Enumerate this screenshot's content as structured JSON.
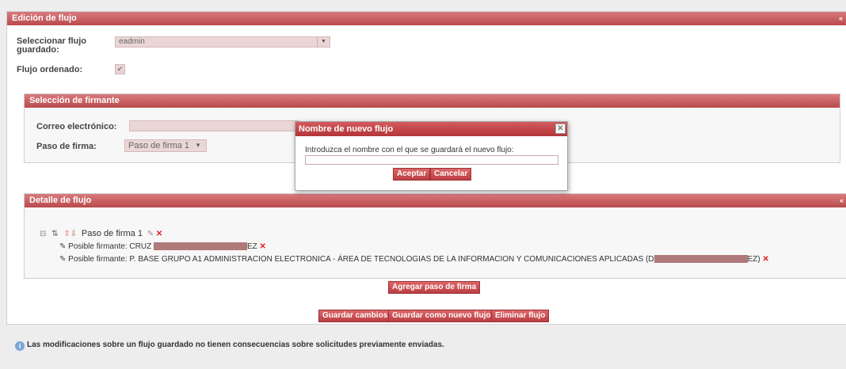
{
  "flow_edit": {
    "title": "Edición de flujo",
    "collapse": "«",
    "select_label": "Seleccionar flujo guardado:",
    "select_value": "eadmin",
    "ordered_label": "Flujo ordenado:",
    "ordered_checked": "✔"
  },
  "signer_select": {
    "title": "Selección de firmante",
    "email_label": "Correo electrónico:",
    "step_label": "Paso de firma:",
    "step_value": "Paso de firma 1"
  },
  "flow_detail": {
    "title": "Detalle de flujo",
    "collapse": "«",
    "step_name": "Paso de firma 1",
    "signers": [
      {
        "prefix": "Posible firmante: CRUZ",
        "suffix": "EZ"
      },
      {
        "prefix": "Posible firmante: P. BASE GRUPO A1 ADMINISTRACION ELECTRONICA - ÁREA DE TECNOLOGIAS DE LA INFORMACION Y COMUNICACIONES APLICADAS (D",
        "suffix": "EZ)"
      }
    ]
  },
  "buttons": {
    "add_step": "Agregar paso de firma",
    "save_changes": "Guardar cambios",
    "save_as_new": "Guardar como nuevo flujo",
    "delete_flow": "Eliminar flujo"
  },
  "info_text": "Las modificaciones sobre un flujo guardado no tienen consecuencias sobre solicitudes previamente enviadas.",
  "modal": {
    "title": "Nombre de nuevo flujo",
    "prompt": "Introduzca el nombre con el que se guardará el nuevo flujo:",
    "input_value": "",
    "accept": "Aceptar",
    "cancel": "Cancelar",
    "close": "✕"
  }
}
